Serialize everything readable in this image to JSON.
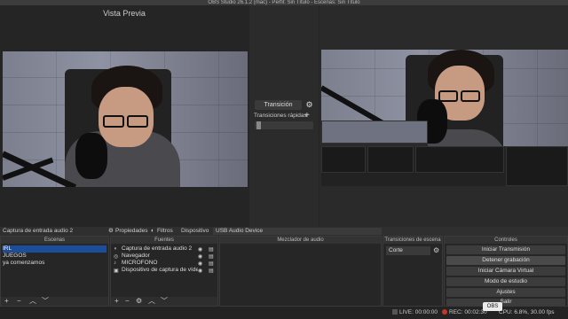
{
  "window": {
    "title": "OBS Studio 26.1.2 (mac) - Perfil: Sin Título - Escenas: Sin Título"
  },
  "preview": {
    "label": "Vista Previa"
  },
  "transition_panel": {
    "transition_button": "Transición",
    "quick_transitions_label": "Transiciones rápidas",
    "add_symbol": "+",
    "gear_symbol": "⚙"
  },
  "toolbar": {
    "selected_source": "Captura de entrada audio 2",
    "properties": "Propiedades",
    "filters": "Filtros",
    "device_label": "Dispositivo",
    "device_value": "USB Audio Device"
  },
  "scenes": {
    "title": "Escenas",
    "items": [
      "IRL",
      "JUEGOS",
      "ya comenzamos"
    ]
  },
  "sources": {
    "title": "Fuentes",
    "items": [
      "Captura de entrada audio 2",
      "Navegador",
      "MICROFONO",
      "Dispositivo de captura de víde"
    ]
  },
  "mixer": {
    "title": "Mezclador de audio"
  },
  "scene_transitions": {
    "title": "Transiciones de escena",
    "selected": "Corte"
  },
  "controls": {
    "title": "Controles",
    "buttons": [
      "Iniciar Transmisión",
      "Detener grabación",
      "Iniciar Cámara Virtual",
      "Modo de estudio",
      "Ajustes",
      "Salir"
    ]
  },
  "status": {
    "live": "LIVE: 00:00:00",
    "rec": "REC: 00:02:30",
    "cpu": "CPU: 6.8%, 30.00 fps"
  },
  "tooltip": "OBS",
  "footer_symbols": {
    "add": "+",
    "remove": "−",
    "gear": "⚙",
    "up": "︿",
    "down": "﹀"
  },
  "colors": {
    "selection": "#1c4d9a",
    "background": "#2a2a2a"
  }
}
